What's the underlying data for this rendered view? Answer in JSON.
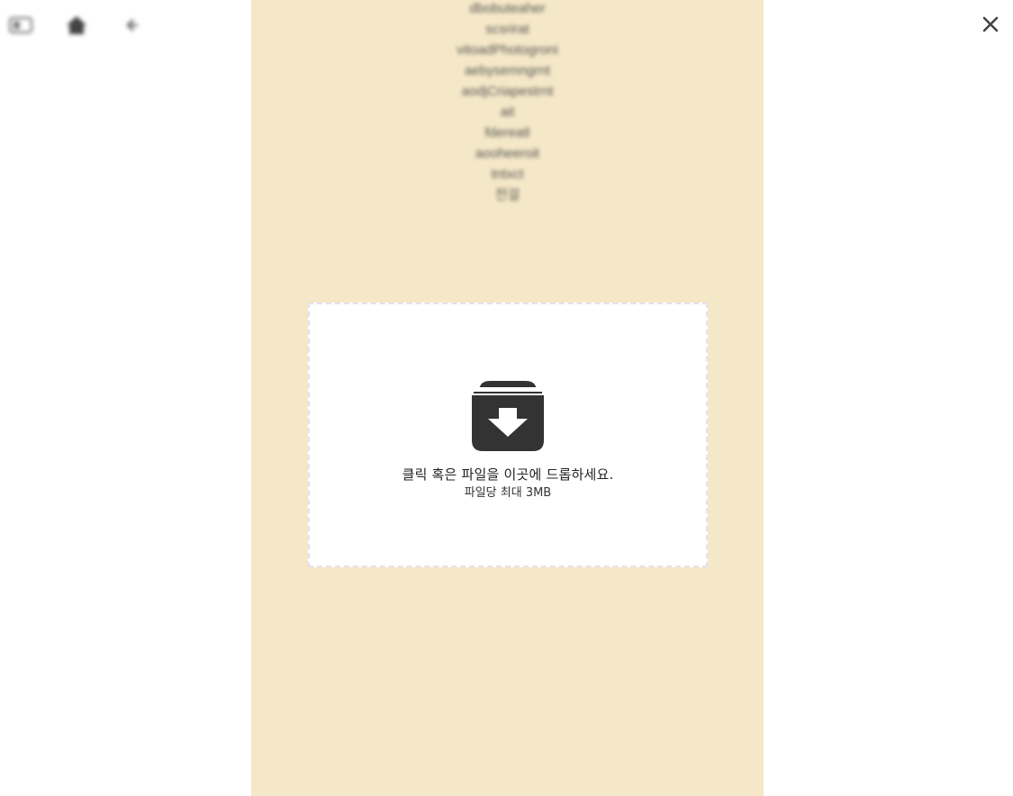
{
  "toolbar": {
    "icons": [
      "menu-icon",
      "home-icon",
      "back-arrow-icon"
    ]
  },
  "close_icon": "close-icon",
  "menu_items": [
    "dbobuteaher",
    "scsrirat",
    "vitoadPhotogroni",
    "aebysemngrnt",
    "aodjCriapestrnt",
    "ait",
    "fdereatl",
    "aooheeroit",
    "tntxct",
    "전걸"
  ],
  "dropzone": {
    "icon": "archive-download-icon",
    "message": "클릭 혹은 파일을 이곳에 드롭하세요.",
    "limit": "파일당 최대 3MB"
  },
  "colors": {
    "column_background": "#f5e8c8",
    "page_background": "#ffffff",
    "icon_dark": "#333333",
    "dropzone_border": "#e6e0ea"
  }
}
